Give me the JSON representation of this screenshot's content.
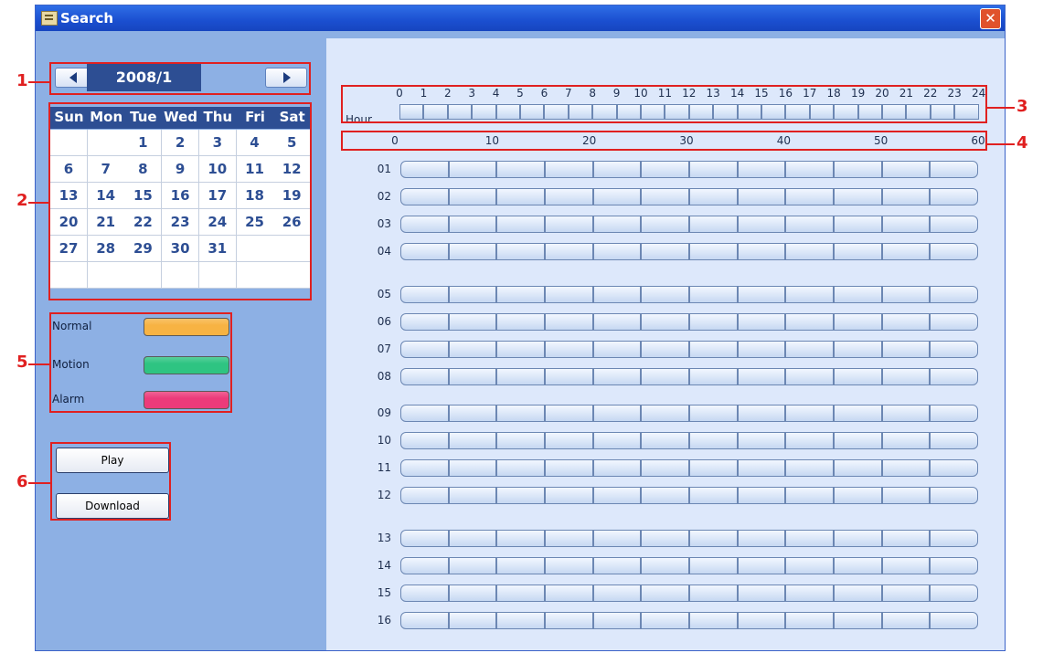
{
  "window": {
    "title": "Search",
    "close_symbol": "✕"
  },
  "calendar": {
    "month_label": "2008/1",
    "prev_symbol": "◀",
    "next_symbol": "▶",
    "day_names": [
      "Sun",
      "Mon",
      "Tue",
      "Wed",
      "Thu",
      "Fri",
      "Sat"
    ],
    "weeks": [
      [
        "",
        "",
        "1",
        "2",
        "3",
        "4",
        "5"
      ],
      [
        "6",
        "7",
        "8",
        "9",
        "10",
        "11",
        "12"
      ],
      [
        "13",
        "14",
        "15",
        "16",
        "17",
        "18",
        "19"
      ],
      [
        "20",
        "21",
        "22",
        "23",
        "24",
        "25",
        "26"
      ],
      [
        "27",
        "28",
        "29",
        "30",
        "31",
        "",
        ""
      ],
      [
        "",
        "",
        "",
        "",
        "",
        "",
        ""
      ]
    ]
  },
  "legend": [
    {
      "label": "Normal",
      "color": "#f7b343"
    },
    {
      "label": "Motion",
      "color": "#2ec482"
    },
    {
      "label": "Alarm",
      "color": "#ec3b7a"
    }
  ],
  "actions": {
    "play_label": "Play",
    "download_label": "Download"
  },
  "timeline": {
    "hour_caption": "Hour",
    "hours": [
      "0",
      "1",
      "2",
      "3",
      "4",
      "5",
      "6",
      "7",
      "8",
      "9",
      "10",
      "11",
      "12",
      "13",
      "14",
      "15",
      "16",
      "17",
      "18",
      "19",
      "20",
      "21",
      "22",
      "23",
      "24"
    ],
    "minutes": [
      "0",
      "10",
      "20",
      "30",
      "40",
      "50",
      "60"
    ],
    "channels": [
      "01",
      "02",
      "03",
      "04",
      "05",
      "06",
      "07",
      "08",
      "09",
      "10",
      "11",
      "12",
      "13",
      "14",
      "15",
      "16"
    ]
  },
  "callouts": [
    "1",
    "2",
    "3",
    "4",
    "5",
    "6"
  ],
  "colors": {
    "annotation": "#e02020",
    "title_bar": "#1b4fd0",
    "header_fill": "#2d4e93"
  }
}
